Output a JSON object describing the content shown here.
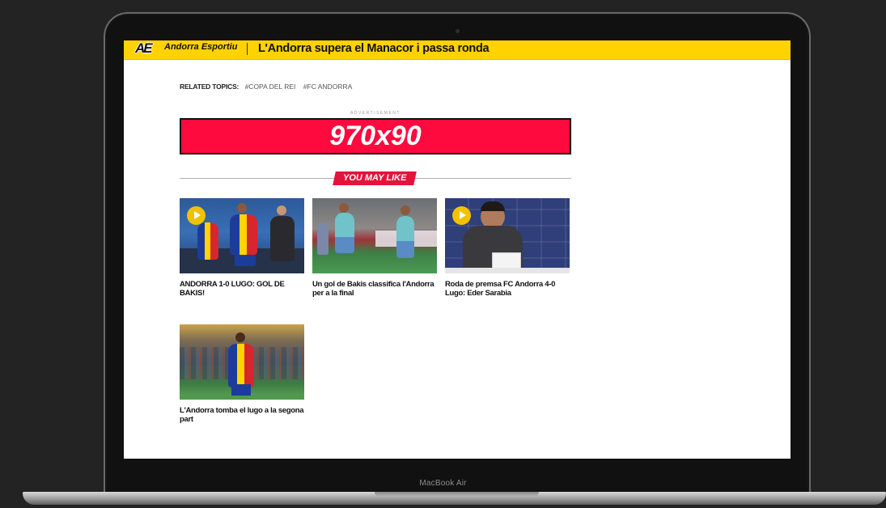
{
  "colors": {
    "header_yellow": "#ffd200",
    "ad_red": "#ff0a3e",
    "badge_red": "#e4133a",
    "play_yellow": "#f2c200"
  },
  "device": {
    "model_label": "MacBook Air"
  },
  "header": {
    "logo_text": "AE",
    "brand_name": "Andorra Esportiu",
    "article_title": "L'Andorra supera el Manacor i passa ronda"
  },
  "related_topics": {
    "label": "RELATED TOPICS:",
    "tags": [
      "#COPA DEL REI",
      "#FC ANDORRA"
    ]
  },
  "advertisement": {
    "caption": "ADVERTISEMENT",
    "text": "970x90"
  },
  "recommendations": {
    "heading": "YOU MAY LIKE",
    "items": [
      {
        "title": "ANDORRA 1-0 LUGO: GOL DE BAKIS!",
        "has_play_icon": true,
        "image_icon": "football-action-photo-icon"
      },
      {
        "title": "Un gol de Bakis classifica l'Andorra per a la final",
        "has_play_icon": false,
        "image_icon": "football-match-photo-icon"
      },
      {
        "title": "Roda de premsa FC Andorra 4-0 Lugo: Eder Sarabia",
        "has_play_icon": true,
        "image_icon": "press-conference-photo-icon"
      },
      {
        "title": "L'Andorra tomba el lugo a la segona part",
        "has_play_icon": false,
        "image_icon": "football-player-photo-icon"
      }
    ]
  }
}
